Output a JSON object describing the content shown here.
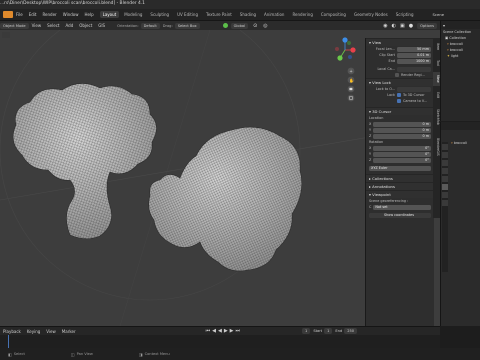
{
  "title_bar": {
    "text": "...rs\\Diner\\Desktop\\WIP\\broccoli scan\\broccoli.blend] - Blender 4.1"
  },
  "menu": [
    "File",
    "Edit",
    "Render",
    "Window",
    "Help"
  ],
  "workspace_tabs": [
    "Layout",
    "Modeling",
    "Sculpting",
    "UV Editing",
    "Texture Paint",
    "Shading",
    "Animation",
    "Rendering",
    "Compositing",
    "Geometry Nodes",
    "Scripting"
  ],
  "active_tab": "Layout",
  "scene": "Scene",
  "header": {
    "mode": "Object Mode",
    "view": "View",
    "select": "Select",
    "add": "Add",
    "object": "Object",
    "gis": "GIS",
    "orientation_label": "Orientation:",
    "orientation_value": "Default",
    "drag_label": "Drag:",
    "drag_value": "Select Box",
    "transform": "Global",
    "options": "Options"
  },
  "npanel": {
    "view_header": "View",
    "focal_label": "Focal Len...",
    "focal_value": "50 mm",
    "clip_start_label": "Clip Start",
    "clip_start_value": "0.01 m",
    "clip_end_label": "End",
    "clip_end_value": "1000 m",
    "local_cam_label": "Local Ca...",
    "render_region_label": "Render Regi...",
    "view_lock_header": "View Lock",
    "lock_to_obj_label": "Lock to O...",
    "lock_label": "Lock",
    "to_3d_cursor": "To 3D Cursor",
    "camera_to_view": "Camera to V...",
    "cursor_header": "3D Cursor",
    "location_label": "Location",
    "loc_x": "0 m",
    "loc_y": "0 m",
    "loc_z": "0 m",
    "rotation_label": "Rotation",
    "rot_x": "0°",
    "rot_y": "0°",
    "rot_z": "0°",
    "rotation_mode": "XYZ Euler",
    "collections_header": "Collections",
    "annotations_header": "Annotations",
    "viewpoint_header": "Viewpoint",
    "georef_label": "Scene georeferencing :",
    "not_set": "Not set",
    "show_coords": "Show coordinates"
  },
  "vtabs": [
    "Item",
    "Tool",
    "View",
    "Edit",
    "Sketchfab",
    "BlenderGIS"
  ],
  "outliner": {
    "scene_collection": "Scene Collection",
    "items": [
      "Collection",
      "broccoli",
      "broccoli",
      "light"
    ]
  },
  "properties": {
    "object_name": "broccoli"
  },
  "timeline": {
    "playback": "Playback",
    "keying": "Keying",
    "view": "View",
    "marker": "Marker",
    "frame": "1",
    "start_label": "Start",
    "start": "1",
    "end_label": "End",
    "end": "250"
  },
  "status": {
    "select": "Select",
    "pan_view": "Pan View",
    "context_menu": "Context Menu"
  },
  "colors": {
    "accent": "#4772b3",
    "gizmo_x": "#e8404a",
    "gizmo_y": "#6bc94a",
    "gizmo_z": "#3d8ee8"
  }
}
